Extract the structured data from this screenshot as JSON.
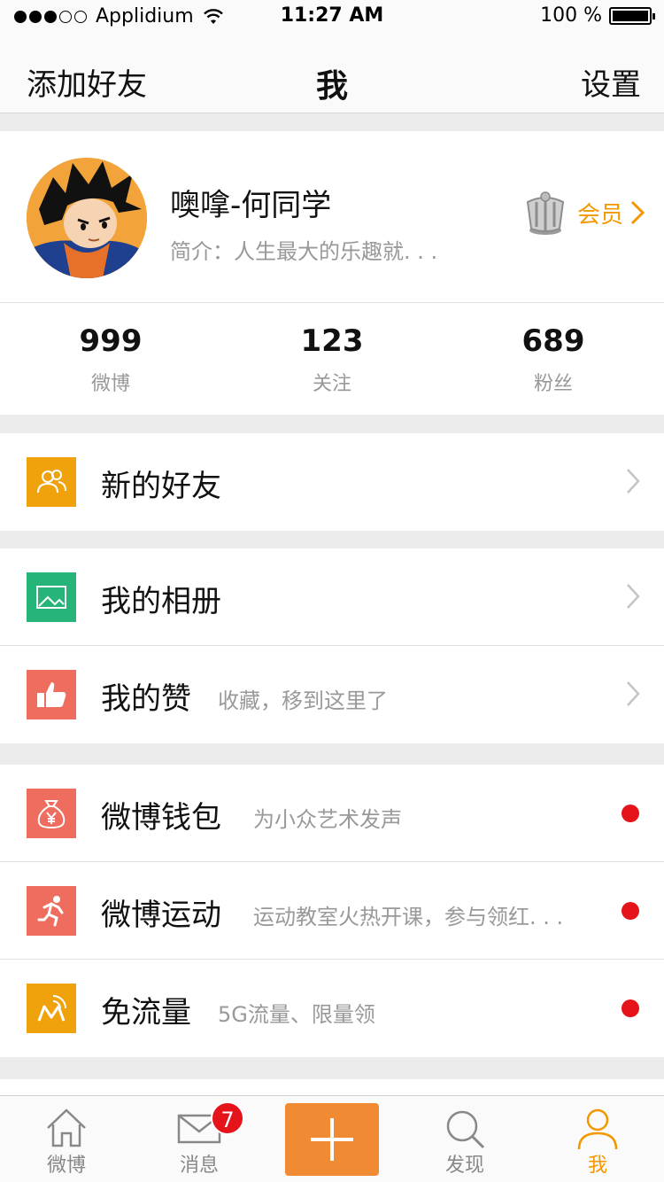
{
  "status": {
    "carrier": "Applidium",
    "time": "11:27 AM",
    "battery": "100 %"
  },
  "nav": {
    "left": "添加好友",
    "title": "我",
    "right": "设置"
  },
  "profile": {
    "name": "噢嗱-何同学",
    "bio": "简介：人生最大的乐趣就. . .",
    "vip_label": "会员",
    "stats": [
      {
        "value": "999",
        "label": "微博"
      },
      {
        "value": "123",
        "label": "关注"
      },
      {
        "value": "689",
        "label": "粉丝"
      }
    ]
  },
  "menu": {
    "new_friends": {
      "title": "新的好友",
      "icon": "friends-icon",
      "color": "#f0a20c"
    },
    "album": {
      "title": "我的相册",
      "icon": "picture-icon",
      "color": "#27b479"
    },
    "likes": {
      "title": "我的赞",
      "subtitle": "收藏，移到这里了",
      "icon": "thumbs-up-icon",
      "color": "#ef6d5f"
    },
    "wallet": {
      "title": "微博钱包",
      "subtitle": "为小众艺术发声",
      "icon": "money-bag-icon",
      "color": "#ef6d5f"
    },
    "sport": {
      "title": "微博运动",
      "subtitle": "运动教室火热开课，参与领红. . .",
      "icon": "runner-icon",
      "color": "#ef6d5f"
    },
    "free_data": {
      "title": "免流量",
      "subtitle": "5G流量、限量领",
      "icon": "signal-icon",
      "color": "#f0a20c"
    }
  },
  "tabs": [
    {
      "label": "微博",
      "icon": "home-icon"
    },
    {
      "label": "消息",
      "icon": "mail-icon",
      "badge": "7"
    },
    {
      "label": "",
      "icon": "plus-icon"
    },
    {
      "label": "发现",
      "icon": "search-icon"
    },
    {
      "label": "我",
      "icon": "person-icon",
      "active": true
    }
  ],
  "colors": {
    "accent": "#f39800",
    "compose": "#f08a33",
    "notify": "#e5141a"
  }
}
